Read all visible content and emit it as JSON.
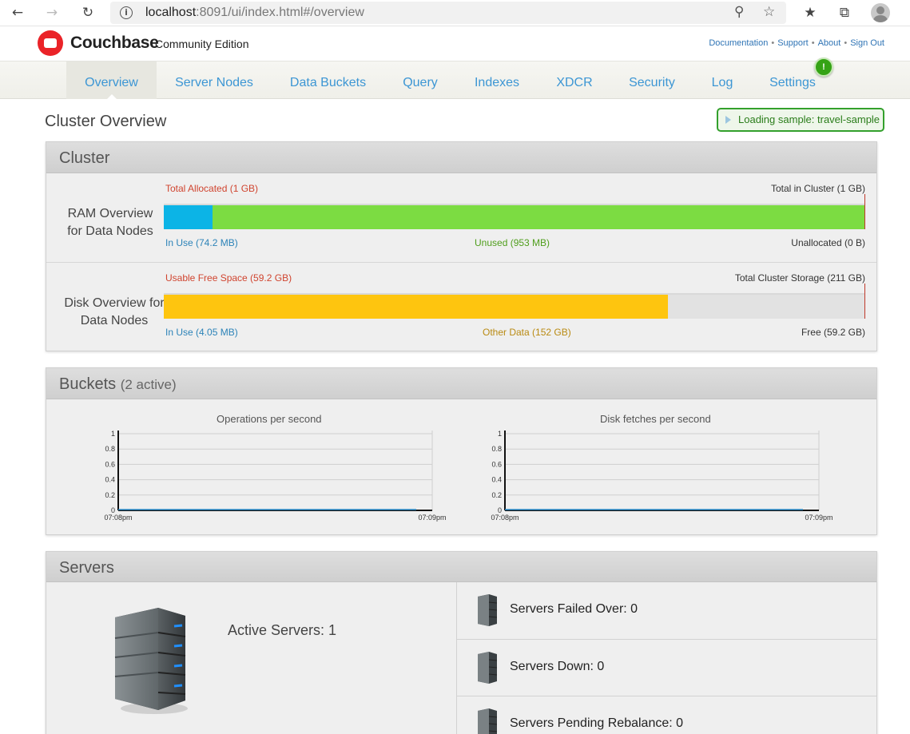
{
  "browser": {
    "url_host": "localhost",
    "url_path": ":8091/ui/index.html#/overview"
  },
  "header": {
    "brand": "Couchbase",
    "edition": "Community Edition",
    "links": [
      "Documentation",
      "Support",
      "About",
      "Sign Out"
    ]
  },
  "nav": {
    "items": [
      "Overview",
      "Server Nodes",
      "Data Buckets",
      "Query",
      "Indexes",
      "XDCR",
      "Security",
      "Log",
      "Settings"
    ],
    "active": "Overview",
    "settings_alert": "!"
  },
  "page": {
    "title": "Cluster Overview",
    "loading_badge": "Loading sample: travel-sample"
  },
  "cluster": {
    "title": "Cluster",
    "ram": {
      "label_line1": "RAM Overview",
      "label_line2": "for Data Nodes",
      "top_left": "Total Allocated (1 GB)",
      "top_right": "Total in Cluster (1 GB)",
      "in_use": "In Use (74.2 MB)",
      "unused": "Unused (953 MB)",
      "unallocated": "Unallocated (0 B)",
      "in_use_fraction": 0.07,
      "unused_fraction": 0.93,
      "colors": {
        "in_use": "#0cb4e6",
        "unused": "#7cdc42"
      }
    },
    "disk": {
      "label_line1": "Disk Overview for",
      "label_line2": "Data Nodes",
      "top_left": "Usable Free Space (59.2 GB)",
      "top_right": "Total Cluster Storage (211 GB)",
      "in_use": "In Use (4.05 MB)",
      "other": "Other Data (152 GB)",
      "free": "Free (59.2 GB)",
      "other_fraction": 0.72,
      "colors": {
        "other": "#fec50f",
        "free": "#e2e2e2"
      }
    }
  },
  "buckets": {
    "title": "Buckets",
    "subtitle": "(2 active)",
    "chart_data": [
      {
        "type": "line",
        "title": "Operations per second",
        "x": [
          "07:08pm",
          "07:09pm"
        ],
        "series": [
          {
            "values": [
              0,
              0
            ]
          }
        ],
        "ylim": [
          0,
          1
        ],
        "yticks": [
          "0",
          "0.2",
          "0.4",
          "0.6",
          "0.8",
          "1"
        ],
        "grid": true
      },
      {
        "type": "line",
        "title": "Disk fetches per second",
        "x": [
          "07:08pm",
          "07:09pm"
        ],
        "series": [
          {
            "values": [
              0,
              0
            ]
          }
        ],
        "ylim": [
          0,
          1
        ],
        "yticks": [
          "0",
          "0.2",
          "0.4",
          "0.6",
          "0.8",
          "1"
        ],
        "grid": true
      }
    ]
  },
  "servers": {
    "title": "Servers",
    "active": "Active Servers: 1",
    "failed_over": "Servers Failed Over: 0",
    "down": "Servers Down: 0",
    "pending": "Servers Pending Rebalance: 0"
  }
}
